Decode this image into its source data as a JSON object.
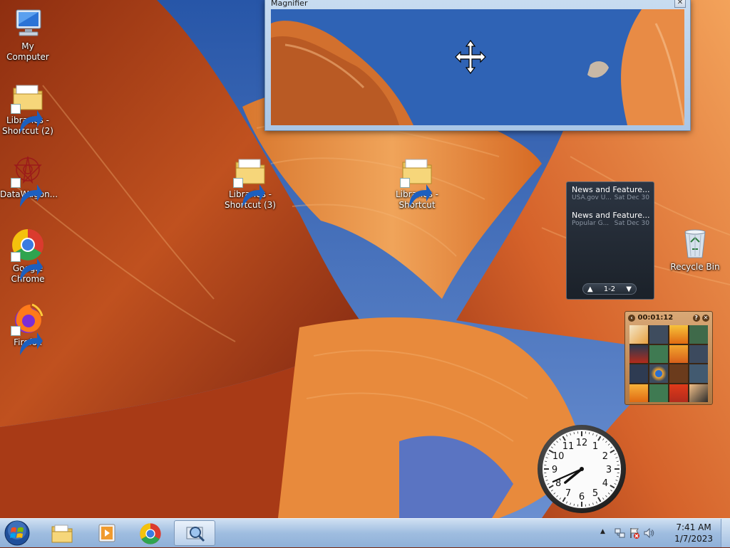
{
  "desktop": {
    "icons": [
      {
        "label": "My Computer"
      },
      {
        "label": "Libraries - Shortcut (2)"
      },
      {
        "label": "DataWagon..."
      },
      {
        "label": "Google Chrome"
      },
      {
        "label": "Firefox"
      },
      {
        "label": "Libraries - Shortcut (3)"
      },
      {
        "label": "Libraries - Shortcut"
      },
      {
        "label": "Recycle Bin"
      }
    ]
  },
  "magnifier": {
    "title": "Magnifier",
    "close_glyph": "✕"
  },
  "news_gadget": {
    "items": [
      {
        "title": "News and Feature...",
        "source": "USA.gov U...",
        "date": "Sat Dec 30"
      },
      {
        "title": "News and Feature...",
        "source": "Popular G...",
        "date": "Sat Dec 30"
      }
    ],
    "pager": {
      "label": "1-2",
      "prev": "▲",
      "next": "▼"
    }
  },
  "puzzle_gadget": {
    "timer": "00:01:12",
    "help": "?",
    "close": "✕",
    "back": "‹"
  },
  "clock_gadget": {
    "numerals": [
      "12",
      "1",
      "2",
      "3",
      "4",
      "5",
      "6",
      "7",
      "8",
      "9",
      "10",
      "11"
    ],
    "hour": 7,
    "minute": 41
  },
  "taskbar": {
    "time": "7:41 AM",
    "date": "1/7/2023",
    "tray_arrow": "▲"
  },
  "colors": {
    "taskbar_top": "#cfe0f2",
    "sky": "#2f63b5",
    "rock": "#c2521f"
  }
}
